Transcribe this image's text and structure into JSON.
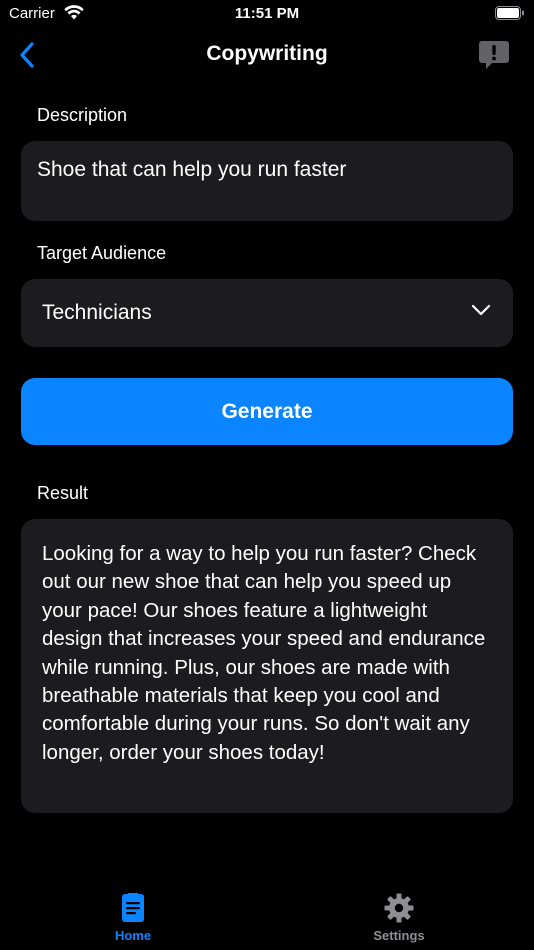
{
  "status_bar": {
    "carrier": "Carrier",
    "time": "11:51 PM"
  },
  "nav": {
    "title": "Copywriting"
  },
  "form": {
    "description_label": "Description",
    "description_value": "Shoe that can help you run faster",
    "audience_label": "Target Audience",
    "audience_value": "Technicians",
    "generate_label": "Generate",
    "result_label": "Result",
    "result_text": "Looking for a way to help you run faster? Check out our new shoe that can help you speed up your pace! Our shoes feature a lightweight design that increases your speed and endurance while running. Plus, our shoes are made with breathable materials that keep you cool and comfortable during your runs. So don't wait any longer, order your shoes today!"
  },
  "tab_bar": {
    "items": [
      {
        "label": "Home",
        "icon": "document-icon",
        "active": true
      },
      {
        "label": "Settings",
        "icon": "gear-icon",
        "active": false
      }
    ]
  },
  "colors": {
    "accent": "#0a84ff",
    "card": "#1c1c1e",
    "inactive": "#8e8e93",
    "background": "#000000"
  }
}
